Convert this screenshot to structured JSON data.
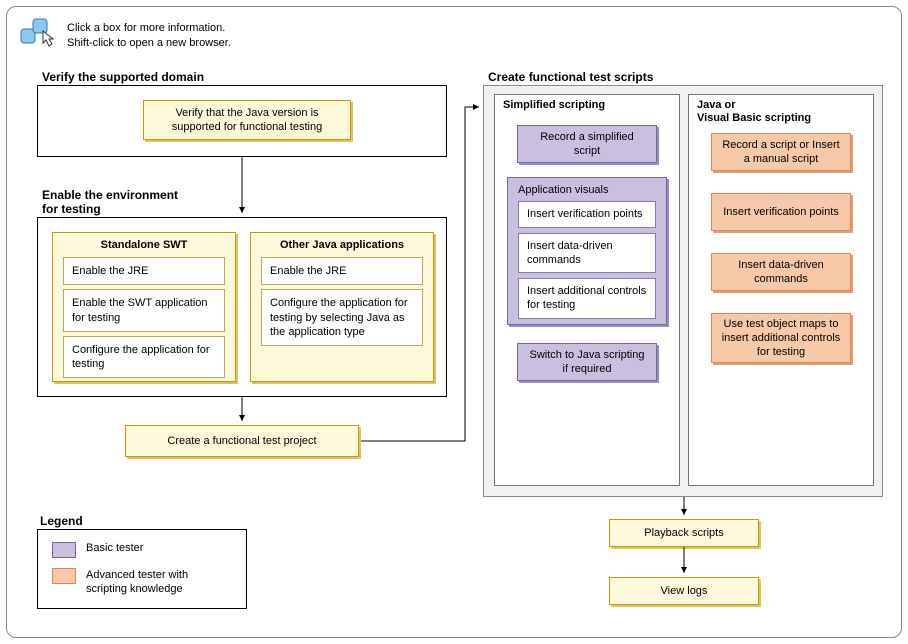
{
  "hint": {
    "l1": "Click a box for more information.",
    "l2": "Shift-click to open a new browser."
  },
  "verify": {
    "title": "Verify the supported domain",
    "box": "Verify that the Java version is supported for functional testing"
  },
  "enable": {
    "title": "Enable the environment for testing",
    "swt": {
      "title": "Standalone SWT",
      "items": [
        "Enable the JRE",
        "Enable the SWT application for testing",
        "Configure the application for testing"
      ]
    },
    "other": {
      "title": "Other Java applications",
      "items": [
        "Enable the JRE",
        "Configure the application for testing by selecting Java as the application type"
      ]
    }
  },
  "create_project": "Create a functional test project",
  "scripts": {
    "title": "Create functional test scripts",
    "simplified": {
      "title": "Simplified scripting",
      "record": "Record a simplified script",
      "visuals": {
        "title": "Application visuals",
        "items": [
          "Insert verification points",
          "Insert data-driven commands",
          "Insert additional controls for testing"
        ]
      },
      "switch": "Switch to Java scripting if required"
    },
    "java": {
      "title": "Java or Visual Basic scripting",
      "items": [
        "Record a script or Insert a manual script",
        "Insert verification points",
        "Insert data-driven commands",
        "Use test object maps to insert additional controls for testing"
      ]
    }
  },
  "playback": "Playback scripts",
  "viewlogs": "View logs",
  "legend": {
    "title": "Legend",
    "basic": "Basic tester",
    "advanced": "Advanced tester with scripting knowledge"
  }
}
